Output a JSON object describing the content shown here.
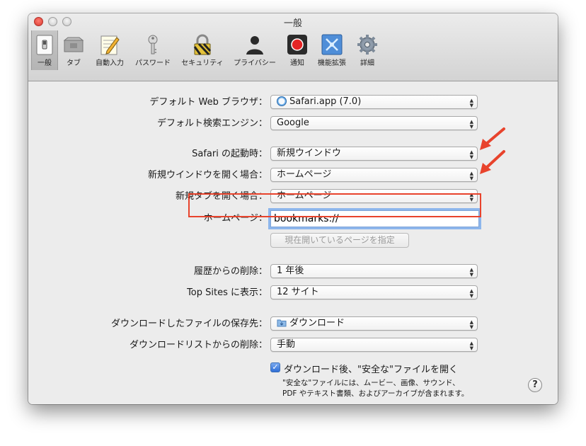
{
  "window": {
    "title": "一般"
  },
  "toolbar": {
    "items": [
      {
        "label": "一般",
        "icon": "general-switch-icon",
        "selected": true
      },
      {
        "label": "タブ",
        "icon": "tabs-icon"
      },
      {
        "label": "自動入力",
        "icon": "autofill-pencil-icon"
      },
      {
        "label": "パスワード",
        "icon": "key-icon"
      },
      {
        "label": "セキュリティ",
        "icon": "lock-icon"
      },
      {
        "label": "プライバシー",
        "icon": "silhouette-icon"
      },
      {
        "label": "通知",
        "icon": "notification-icon"
      },
      {
        "label": "機能拡張",
        "icon": "puzzle-icon"
      },
      {
        "label": "詳細",
        "icon": "gear-icon"
      }
    ]
  },
  "settings": {
    "default_browser": {
      "label": "デフォルト Web ブラウザ：",
      "value": "Safari.app (7.0)"
    },
    "default_search": {
      "label": "デフォルト検索エンジン：",
      "value": "Google"
    },
    "safari_opens_with": {
      "label": "Safari の起動時：",
      "value": "新規ウインドウ"
    },
    "new_windows_open": {
      "label": "新規ウインドウを開く場合：",
      "value": "ホームページ"
    },
    "new_tabs_open": {
      "label": "新規タブを開く場合：",
      "value": "ホームページ"
    },
    "homepage": {
      "label": "ホームページ：",
      "value": "bookmarks://"
    },
    "set_current_page_button": "現在開いているページを指定",
    "remove_history": {
      "label": "履歴からの削除：",
      "value": "1 年後"
    },
    "top_sites": {
      "label": "Top Sites に表示：",
      "value": "12 サイト"
    },
    "download_location": {
      "label": "ダウンロードしたファイルの保存先：",
      "value": "ダウンロード"
    },
    "remove_download_list": {
      "label": "ダウンロードリストからの削除：",
      "value": "手動"
    },
    "open_safe_files": {
      "label": "ダウンロード後、\"安全な\"ファイルを開く",
      "checked": true,
      "note_line1": "\"安全な\"ファイルには、ムービー、画像、サウンド、",
      "note_line2": "PDF やテキスト書類、およびアーカイブが含まれます。"
    },
    "help_label": "?"
  },
  "colors": {
    "annotation": "#e8432c",
    "focus_ring": "#8db6ec"
  }
}
